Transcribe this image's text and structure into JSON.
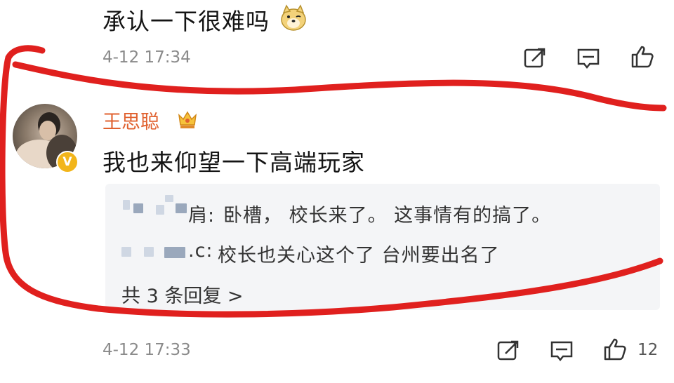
{
  "comment1": {
    "text": "承认一下很难吗",
    "emoji": "doge-face-emoji",
    "time": "4-12 17:34"
  },
  "comment2": {
    "username": "王思聪",
    "text": "我也来仰望一下高端玩家",
    "replies": [
      {
        "author_suffix": "肩:",
        "text": "卧槽， 校长来了。 这事情有的搞了。"
      },
      {
        "author_suffix": ".c:",
        "text": "校长也关心这个了 台州要出名了"
      }
    ],
    "more_replies": "共 3 条回复 >",
    "time": "4-12 17:33",
    "like_count": "12"
  },
  "icons": {
    "share": "share-icon",
    "comment": "comment-icon",
    "like": "thumbs-up-icon",
    "vip": "crown-badge-icon",
    "verified": "verified-v-icon"
  },
  "colors": {
    "username": "#e0612f",
    "annotation": "#e0201e",
    "meta": "#8a8a8a"
  }
}
